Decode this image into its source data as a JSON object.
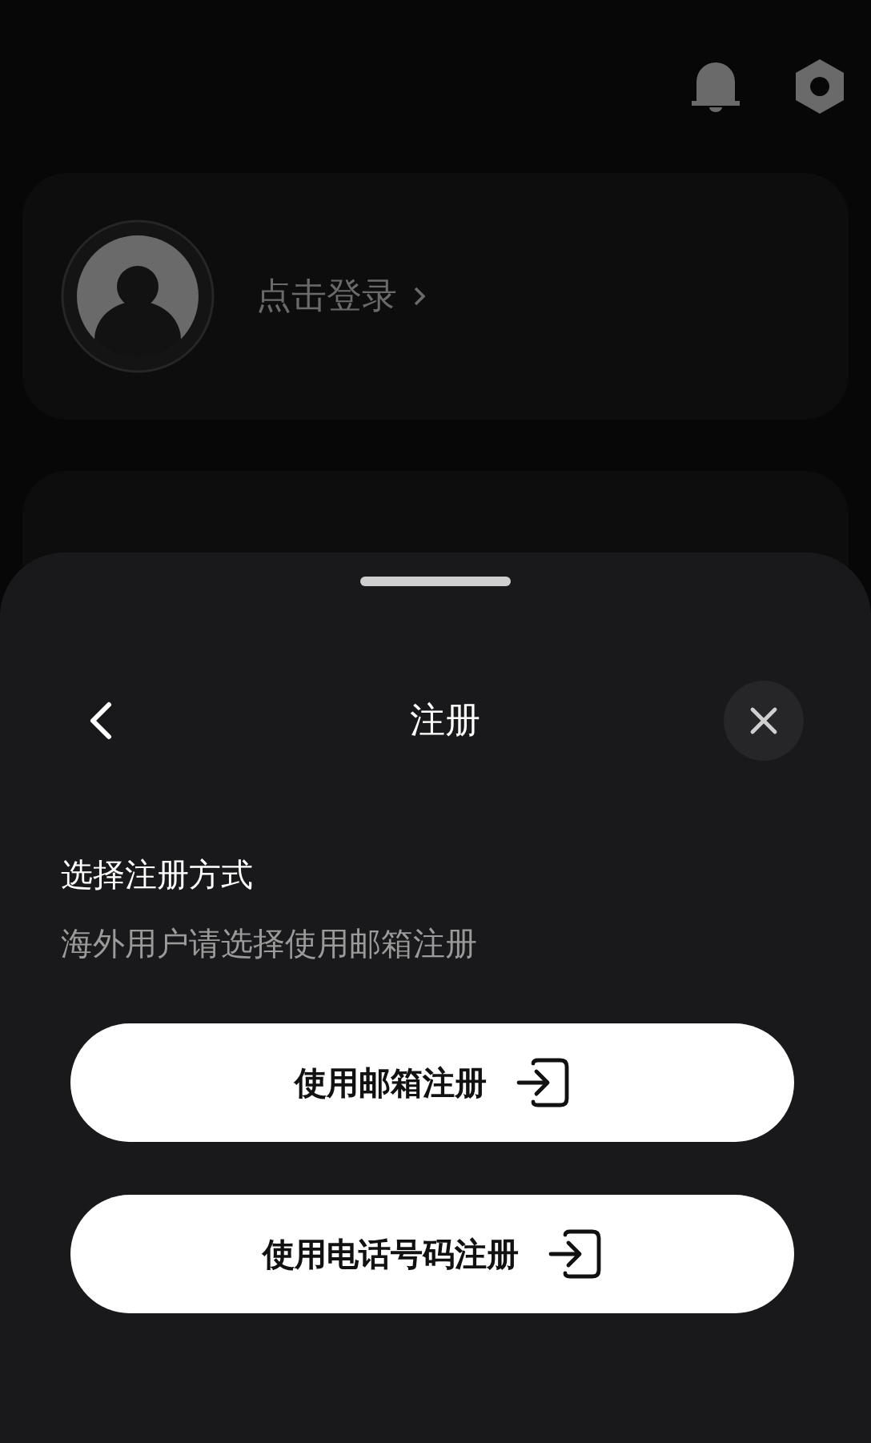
{
  "profile_card": {
    "login_text": "点击登录"
  },
  "sheet": {
    "title": "注册",
    "heading": "选择注册方式",
    "subtitle": "海外用户请选择使用邮箱注册",
    "buttons": [
      {
        "label": "使用邮箱注册"
      },
      {
        "label": "使用电话号码注册"
      }
    ]
  }
}
